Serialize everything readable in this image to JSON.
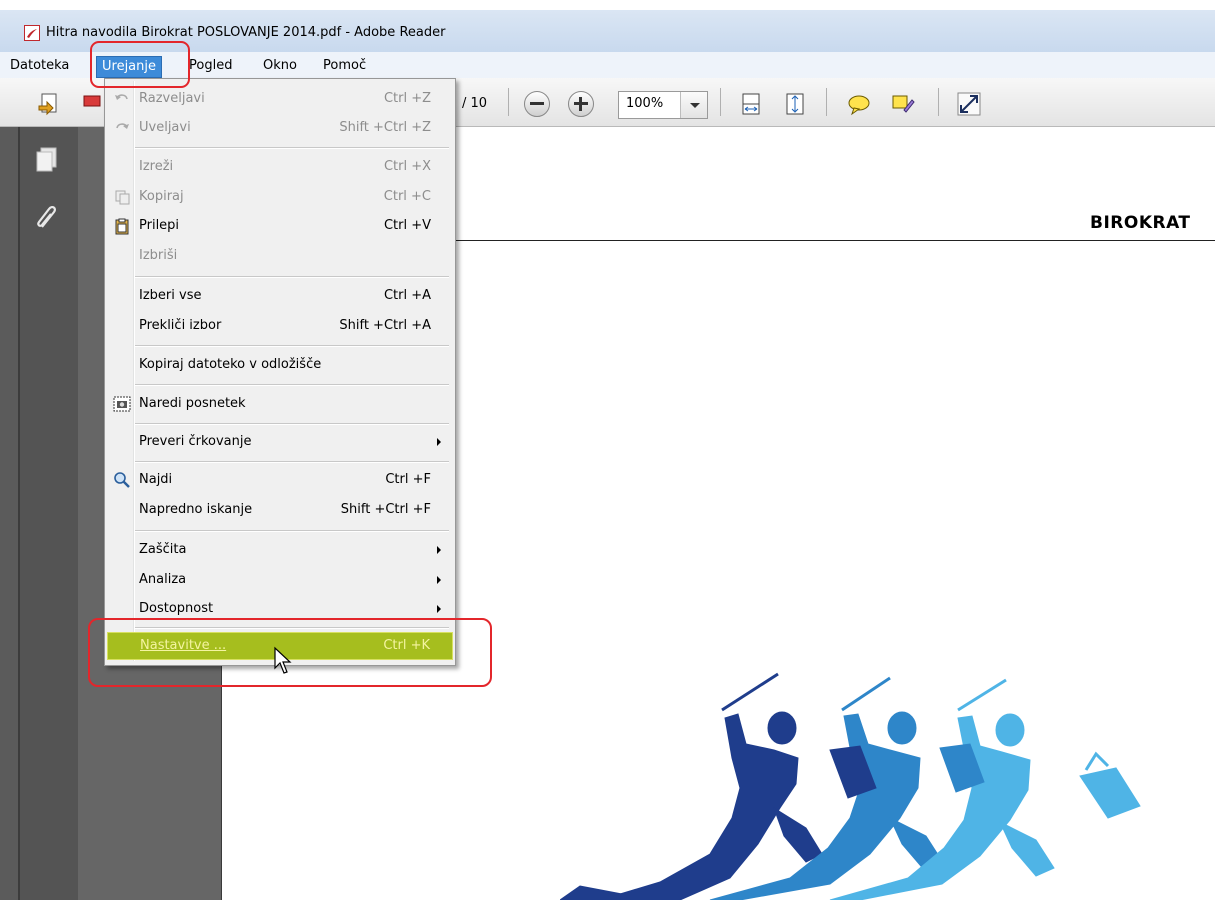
{
  "window": {
    "title": "Hitra navodila Birokrat POSLOVANJE 2014.pdf - Adobe Reader"
  },
  "menubar": {
    "items": [
      {
        "label": "Datoteka"
      },
      {
        "label": "Urejanje"
      },
      {
        "label": "Pogled"
      },
      {
        "label": "Okno"
      },
      {
        "label": "Pomoč"
      }
    ],
    "active": "Urejanje"
  },
  "toolbar": {
    "page_count": "/ 10",
    "zoom": "100%"
  },
  "edit_menu": {
    "items": [
      {
        "label": "Razveljavi",
        "shortcut": "Ctrl +Z",
        "disabled": true,
        "icon": "undo-icon"
      },
      {
        "label": "Uveljavi",
        "shortcut": "Shift +Ctrl +Z",
        "disabled": true,
        "icon": "redo-icon"
      },
      {
        "label": "Izreži",
        "shortcut": "Ctrl +X",
        "disabled": true
      },
      {
        "label": "Kopiraj",
        "shortcut": "Ctrl +C",
        "disabled": true,
        "icon": "copy-icon"
      },
      {
        "label": "Prilepi",
        "shortcut": "Ctrl +V",
        "disabled": false,
        "icon": "paste-icon"
      },
      {
        "label": "Izbriši",
        "shortcut": "",
        "disabled": true
      },
      {
        "label": "Izberi vse",
        "shortcut": "Ctrl +A",
        "disabled": false
      },
      {
        "label": "Prekliči izbor",
        "shortcut": "Shift +Ctrl +A",
        "disabled": false
      },
      {
        "label": "Kopiraj datoteko v odložišče",
        "shortcut": "",
        "disabled": false
      },
      {
        "label": "Naredi posnetek",
        "shortcut": "",
        "disabled": false,
        "icon": "camera-icon"
      },
      {
        "label": "Preveri črkovanje",
        "shortcut": "",
        "disabled": false,
        "submenu": true
      },
      {
        "label": "Najdi",
        "shortcut": "Ctrl +F",
        "disabled": false,
        "icon": "search-icon"
      },
      {
        "label": "Napredno iskanje",
        "shortcut": "Shift +Ctrl +F",
        "disabled": false
      },
      {
        "label": "Zaščita",
        "shortcut": "",
        "disabled": false,
        "submenu": true
      },
      {
        "label": "Analiza",
        "shortcut": "",
        "disabled": false,
        "submenu": true
      },
      {
        "label": "Dostopnost",
        "shortcut": "",
        "disabled": false,
        "submenu": true
      },
      {
        "label": "Nastavitve ...",
        "shortcut": "Ctrl +K",
        "disabled": false,
        "highlighted": true
      }
    ]
  },
  "document": {
    "heading": "BIROKRAT"
  },
  "colors": {
    "highlight": "#a6be1e",
    "annotation": "#e3262b",
    "menu_active": "#3d8bd9",
    "figure_dark": "#1f3d8c",
    "figure_mid": "#2e86c9",
    "figure_light": "#4fb4e6"
  }
}
